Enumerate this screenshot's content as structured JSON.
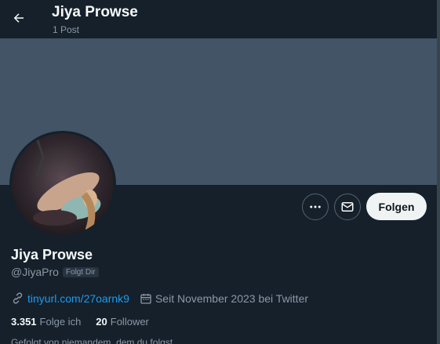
{
  "header": {
    "title": "Jiya Prowse",
    "post_count": "1 Post"
  },
  "profile": {
    "display_name": "Jiya Prowse",
    "handle": "@JiyaPro",
    "follows_you_badge": "Folgt Dir",
    "link": "tinyurl.com/27oarnk9",
    "joined": "Seit November 2023 bei Twitter",
    "following_count": "3.351",
    "following_label": "Folge ich",
    "followers_count": "20",
    "followers_label": "Follower",
    "followed_by_text": "Gefolgt von niemandem, dem du folgst"
  },
  "actions": {
    "follow_label": "Folgen"
  },
  "icons": [
    "back-arrow-icon",
    "more-icon",
    "mail-icon",
    "link-icon",
    "calendar-icon"
  ],
  "colors": {
    "background": "#15202b",
    "banner": "#425466",
    "link": "#1d9bf0",
    "follow_button_bg": "#eff3f4",
    "muted_text": "#8b98a5"
  }
}
